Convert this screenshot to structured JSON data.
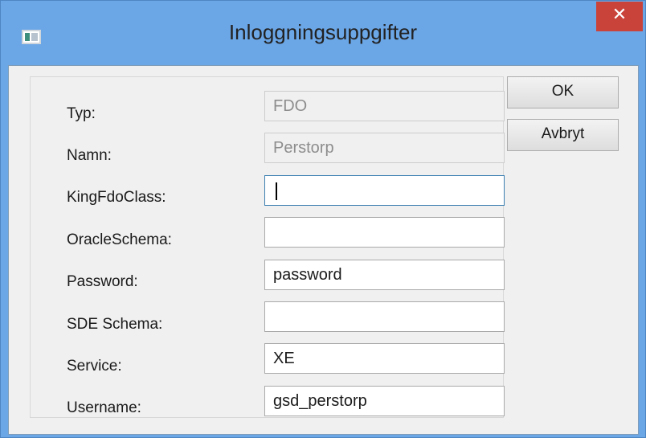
{
  "window": {
    "title": "Inloggningsuppgifter",
    "close_symbol": "✕"
  },
  "form": {
    "fields": [
      {
        "label": "Typ:",
        "value": "FDO",
        "readonly": true
      },
      {
        "label": "Namn:",
        "value": "Perstorp",
        "readonly": true
      },
      {
        "label": "KingFdoClass:",
        "value": "",
        "readonly": false,
        "focused": true
      },
      {
        "label": "OracleSchema:",
        "value": "",
        "readonly": false
      },
      {
        "label": "Password:",
        "value": "password",
        "readonly": false
      },
      {
        "label": "SDE Schema:",
        "value": "",
        "readonly": false
      },
      {
        "label": "Service:",
        "value": "XE",
        "readonly": false
      },
      {
        "label": "Username:",
        "value": "gsd_perstorp",
        "readonly": false
      }
    ]
  },
  "buttons": {
    "ok_label": "OK",
    "cancel_label": "Avbryt"
  },
  "icons": {
    "app": "app-window-icon",
    "close": "close-icon"
  },
  "colors": {
    "titlebar": "#6ba6e6",
    "close_button": "#c9433b",
    "client_bg": "#f0f0f0"
  }
}
